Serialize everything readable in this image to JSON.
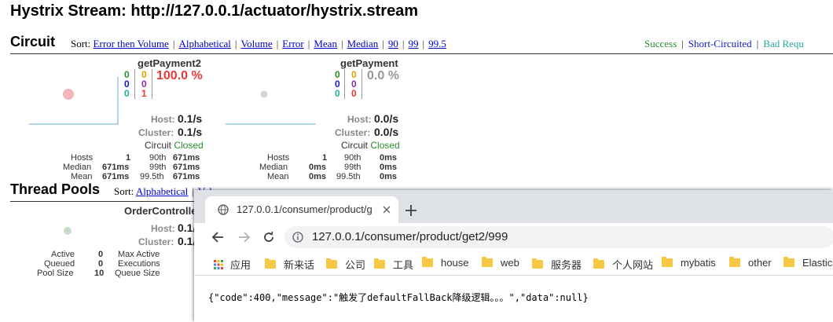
{
  "page_title": "Hystrix Stream: http://127.0.0.1/actuator/hystrix.stream",
  "circuit_section": {
    "title": "Circuit",
    "sort_label": "Sort:",
    "sort_options": [
      "Error then Volume",
      "Alphabetical",
      "Volume",
      "Error",
      "Mean",
      "Median",
      "90",
      "99",
      "99.5"
    ],
    "legend": [
      "Success",
      "Short-Circuited",
      "Bad Requ"
    ]
  },
  "circuits": [
    {
      "name": "getPayment2",
      "counts_left": [
        "0",
        "0",
        "0"
      ],
      "counts_right": [
        "0",
        "0",
        "1"
      ],
      "error_rate": "100.0 %",
      "host_label": "Host:",
      "host_rate": "0.1/s",
      "cluster_label": "Cluster:",
      "cluster_rate": "0.1/s",
      "circuit_label": "Circuit",
      "circuit_status": "Closed",
      "stats": {
        "hosts_label": "Hosts",
        "hosts": "1",
        "median_label": "Median",
        "median": "671ms",
        "mean_label": "Mean",
        "mean": "671ms",
        "p90_label": "90th",
        "p90": "671ms",
        "p99_label": "99th",
        "p99": "671ms",
        "p995_label": "99.5th",
        "p995": "671ms"
      }
    },
    {
      "name": "getPayment",
      "counts_left": [
        "0",
        "0",
        "0"
      ],
      "counts_right": [
        "0",
        "0",
        "0"
      ],
      "error_rate": "0.0 %",
      "host_label": "Host:",
      "host_rate": "0.0/s",
      "cluster_label": "Cluster:",
      "cluster_rate": "0.0/s",
      "circuit_label": "Circuit",
      "circuit_status": "Closed",
      "stats": {
        "hosts_label": "Hosts",
        "hosts": "1",
        "median_label": "Median",
        "median": "0ms",
        "mean_label": "Mean",
        "mean": "0ms",
        "p90_label": "90th",
        "p90": "0ms",
        "p99_label": "99th",
        "p99": "0ms",
        "p995_label": "99.5th",
        "p995": "0ms"
      }
    }
  ],
  "thread_pools": {
    "title": "Thread Pools",
    "sort_label": "Sort:",
    "sort_options": [
      "Alphabetical",
      "Volu"
    ],
    "pool": {
      "name": "OrderControlle",
      "host_label": "Host:",
      "host_rate": "0.1/",
      "cluster_label": "Cluster:",
      "cluster_rate": "0.1/",
      "active_label": "Active",
      "active": "0",
      "queued_label": "Queued",
      "queued": "0",
      "pool_size_label": "Pool Size",
      "pool_size": "10",
      "max_active_label": "Max Active",
      "executions_label": "Executions",
      "queue_size_label": "Queue Size"
    }
  },
  "browser": {
    "tab_title": "127.0.0.1/consumer/product/g",
    "url": "127.0.0.1/consumer/product/get2/999",
    "bookmarks": [
      "应用",
      "新来话",
      "公司",
      "工具",
      "house",
      "web",
      "服务器",
      "个人网站",
      "mybatis",
      "other",
      "Elastics"
    ],
    "response": "{\"code\":400,\"message\":\"触发了defaultFallBack降级逻辑。。。\",\"data\":null}"
  },
  "colors": {
    "success": "#2c8c2c",
    "short_circuited": "#1919c8",
    "bad_request": "#26aa9a",
    "error_rate": "#e83838",
    "link": "#0000cc"
  }
}
